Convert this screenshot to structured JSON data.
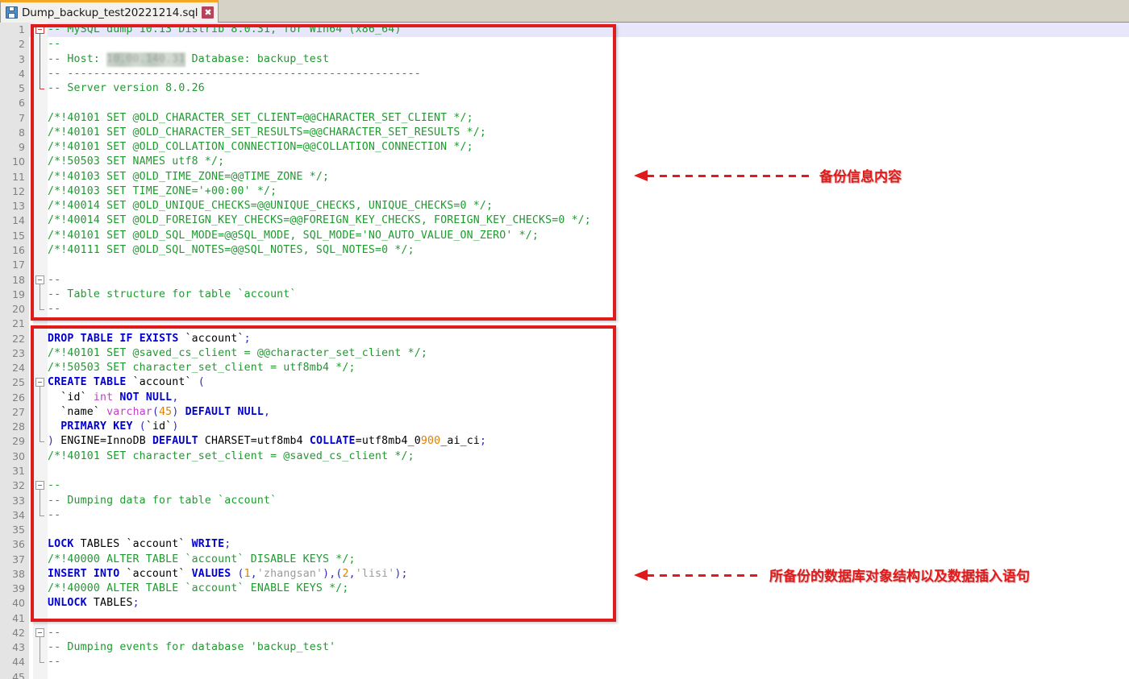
{
  "window": {
    "tab": {
      "title": "Dump_backup_test20221214.sql",
      "save_icon": "floppy-disk-icon",
      "close_label": "✖"
    }
  },
  "editor": {
    "first_line": 1,
    "last_visible_line": 45,
    "highlighted_line": 1,
    "lines": [
      {
        "n": 1,
        "text": "-- MySQL dump 10.13  Distrib 8.0.31, for Win64 (x86_64)"
      },
      {
        "n": 2,
        "text": "--"
      },
      {
        "n": 3,
        "text": "-- Host: 10.00.140.31    Database: backup_test"
      },
      {
        "n": 4,
        "text": "-- ------------------------------------------------------"
      },
      {
        "n": 5,
        "text": "-- Server version   8.0.26"
      },
      {
        "n": 6,
        "text": ""
      },
      {
        "n": 7,
        "text": "/*!40101 SET @OLD_CHARACTER_SET_CLIENT=@@CHARACTER_SET_CLIENT */;"
      },
      {
        "n": 8,
        "text": "/*!40101 SET @OLD_CHARACTER_SET_RESULTS=@@CHARACTER_SET_RESULTS */;"
      },
      {
        "n": 9,
        "text": "/*!40101 SET @OLD_COLLATION_CONNECTION=@@COLLATION_CONNECTION */;"
      },
      {
        "n": 10,
        "text": "/*!50503 SET NAMES utf8 */;"
      },
      {
        "n": 11,
        "text": "/*!40103 SET @OLD_TIME_ZONE=@@TIME_ZONE */;"
      },
      {
        "n": 12,
        "text": "/*!40103 SET TIME_ZONE='+00:00' */;"
      },
      {
        "n": 13,
        "text": "/*!40014 SET @OLD_UNIQUE_CHECKS=@@UNIQUE_CHECKS, UNIQUE_CHECKS=0 */;"
      },
      {
        "n": 14,
        "text": "/*!40014 SET @OLD_FOREIGN_KEY_CHECKS=@@FOREIGN_KEY_CHECKS, FOREIGN_KEY_CHECKS=0 */;"
      },
      {
        "n": 15,
        "text": "/*!40101 SET @OLD_SQL_MODE=@@SQL_MODE, SQL_MODE='NO_AUTO_VALUE_ON_ZERO' */;"
      },
      {
        "n": 16,
        "text": "/*!40111 SET @OLD_SQL_NOTES=@@SQL_NOTES, SQL_NOTES=0 */;"
      },
      {
        "n": 17,
        "text": ""
      },
      {
        "n": 18,
        "text": "--"
      },
      {
        "n": 19,
        "text": "-- Table structure for table `account`"
      },
      {
        "n": 20,
        "text": "--"
      },
      {
        "n": 21,
        "text": ""
      },
      {
        "n": 22,
        "text": "DROP TABLE IF EXISTS `account`;"
      },
      {
        "n": 23,
        "text": "/*!40101 SET @saved_cs_client     = @@character_set_client */;"
      },
      {
        "n": 24,
        "text": "/*!50503 SET character_set_client = utf8mb4 */;"
      },
      {
        "n": 25,
        "text": "CREATE TABLE `account` ("
      },
      {
        "n": 26,
        "text": "  `id` int NOT NULL,"
      },
      {
        "n": 27,
        "text": "  `name` varchar(45) DEFAULT NULL,"
      },
      {
        "n": 28,
        "text": "  PRIMARY KEY (`id`)"
      },
      {
        "n": 29,
        "text": ") ENGINE=InnoDB DEFAULT CHARSET=utf8mb4 COLLATE=utf8mb4_0900_ai_ci;"
      },
      {
        "n": 30,
        "text": "/*!40101 SET character_set_client = @saved_cs_client */;"
      },
      {
        "n": 31,
        "text": ""
      },
      {
        "n": 32,
        "text": "--"
      },
      {
        "n": 33,
        "text": "-- Dumping data for table `account`"
      },
      {
        "n": 34,
        "text": "--"
      },
      {
        "n": 35,
        "text": ""
      },
      {
        "n": 36,
        "text": "LOCK TABLES `account` WRITE;"
      },
      {
        "n": 37,
        "text": "/*!40000 ALTER TABLE `account` DISABLE KEYS */;"
      },
      {
        "n": 38,
        "text": "INSERT INTO `account` VALUES (1,'zhangsan'),(2,'lisi');"
      },
      {
        "n": 39,
        "text": "/*!40000 ALTER TABLE `account` ENABLE KEYS */;"
      },
      {
        "n": 40,
        "text": "UNLOCK TABLES;"
      },
      {
        "n": 41,
        "text": ""
      },
      {
        "n": 42,
        "text": "--"
      },
      {
        "n": 43,
        "text": "-- Dumping events for database 'backup_test'"
      },
      {
        "n": 44,
        "text": "--"
      },
      {
        "n": 45,
        "text": ""
      }
    ]
  },
  "annotations": {
    "accent_color": "#e01b1b",
    "items": [
      {
        "label": "备份信息内容"
      },
      {
        "label": "所备份的数据库对象结构以及数据插入语句"
      }
    ]
  }
}
